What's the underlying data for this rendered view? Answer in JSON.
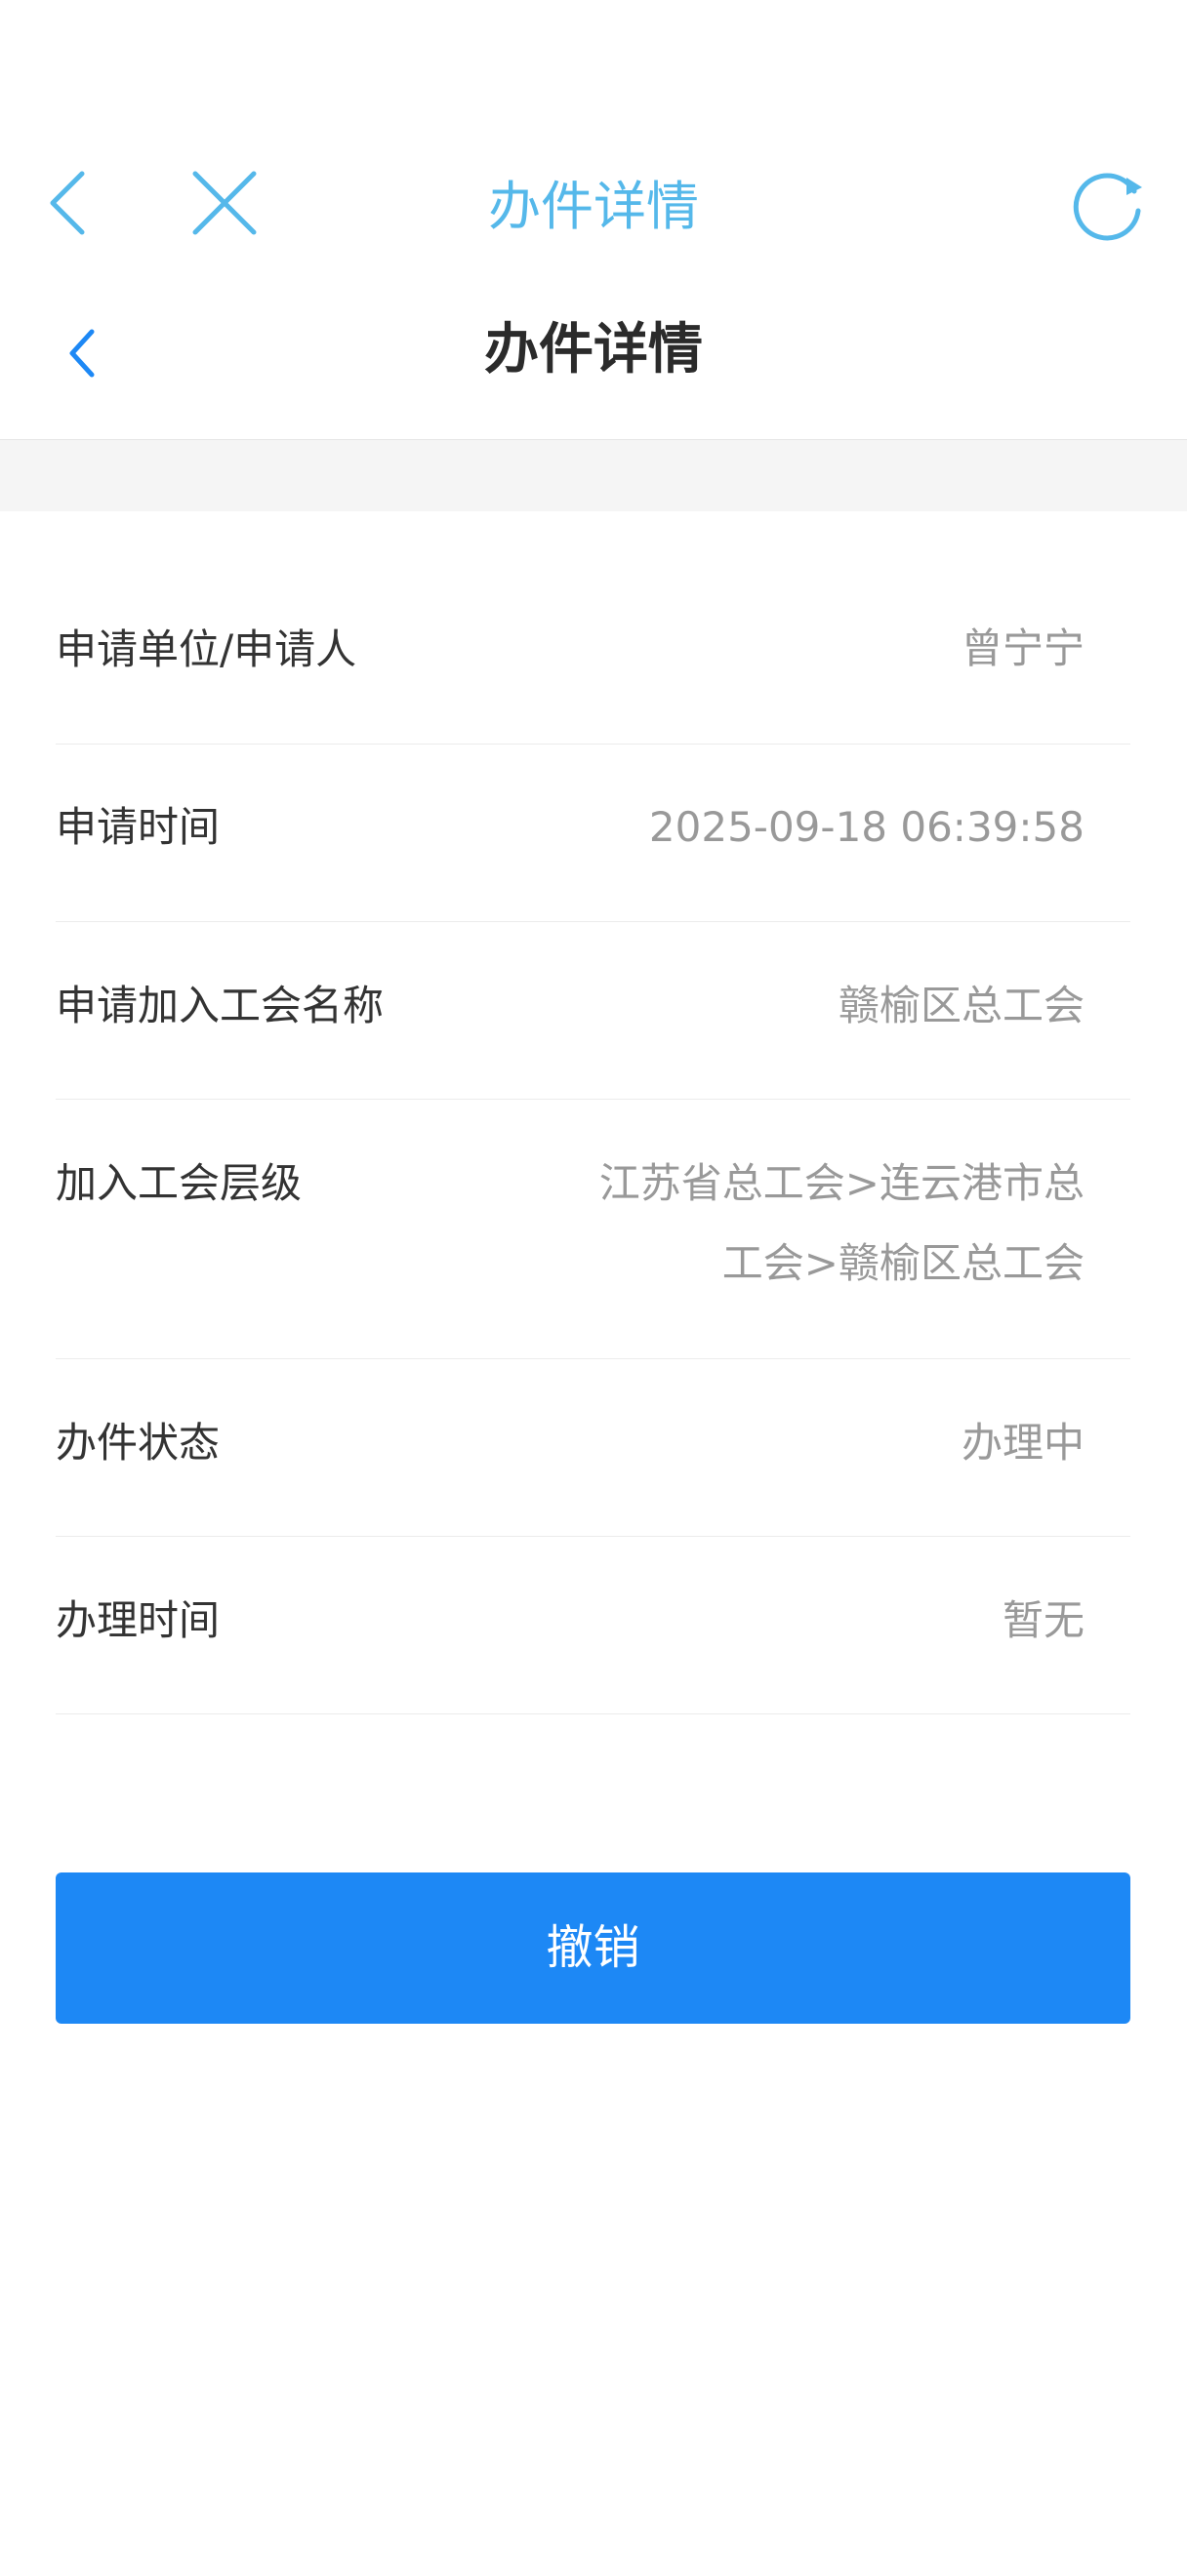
{
  "outer_nav": {
    "title": "办件详情",
    "accent_color": "#55b8ea",
    "icons": [
      "chevron-left-icon",
      "close-icon",
      "refresh-icon"
    ]
  },
  "inner_nav": {
    "title": "办件详情",
    "back_icon": "chevron-left-icon",
    "back_color": "#1d88f5"
  },
  "details": [
    {
      "label": "申请单位/申请人",
      "value": "曾宁宁"
    },
    {
      "label": "申请时间",
      "value": "2025-09-18 06:39:58"
    },
    {
      "label": "申请加入工会名称",
      "value": "赣榆区总工会"
    },
    {
      "label": "加入工会层级",
      "value": "江苏省总工会>连云港市总工会>赣榆区总工会"
    },
    {
      "label": "办件状态",
      "value": "办理中"
    },
    {
      "label": "办理时间",
      "value": "暂无"
    }
  ],
  "actions": {
    "cancel_label": "撤销",
    "cancel_color": "#1d88f5"
  }
}
